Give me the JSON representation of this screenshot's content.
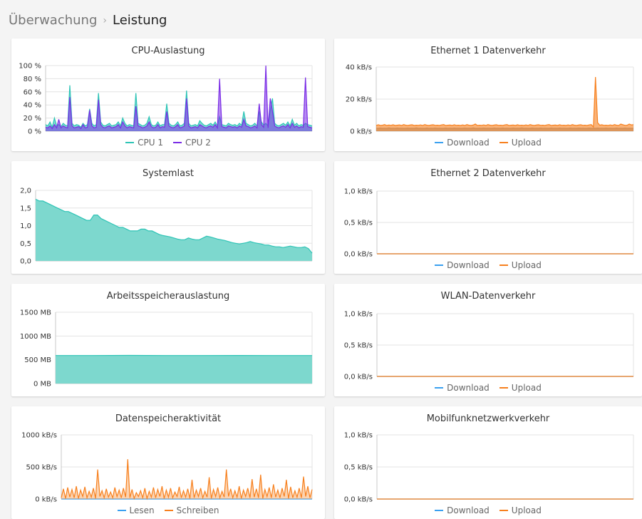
{
  "breadcrumb": {
    "parent": "Überwachung",
    "separator": "›",
    "current": "Leistung"
  },
  "colors": {
    "teal": "#2ec4b6",
    "teal_fill": "#7dd8ce",
    "purple": "#7a2ce6",
    "orange": "#f7801e",
    "blue": "#3aa0f0",
    "gray": "#9a9a9a"
  },
  "panels": {
    "cpu": {
      "title": "CPU-Auslastung",
      "y_ticks": [
        "100 %",
        "80 %",
        "60 %",
        "40 %",
        "20 %",
        "0 %"
      ],
      "legend": [
        "CPU 1",
        "CPU 2"
      ]
    },
    "eth1": {
      "title": "Ethernet 1 Datenverkehr",
      "y_ticks": [
        "40 kB/s",
        "20 kB/s",
        "0 kB/s"
      ],
      "legend": [
        "Download",
        "Upload"
      ]
    },
    "load": {
      "title": "Systemlast",
      "y_ticks": [
        "2,0",
        "1,5",
        "1,0",
        "0,5",
        "0,0"
      ]
    },
    "eth2": {
      "title": "Ethernet 2 Datenverkehr",
      "y_ticks": [
        "1,0 kB/s",
        "0,5 kB/s",
        "0,0 kB/s"
      ],
      "legend": [
        "Download",
        "Upload"
      ]
    },
    "mem": {
      "title": "Arbeitsspeicherauslastung",
      "y_ticks": [
        "1500 MB",
        "1000 MB",
        "500 MB",
        "0 MB"
      ]
    },
    "wlan": {
      "title": "WLAN-Datenverkehr",
      "y_ticks": [
        "1,0 kB/s",
        "0,5 kB/s",
        "0,0 kB/s"
      ],
      "legend": [
        "Download",
        "Upload"
      ]
    },
    "disk": {
      "title": "Datenspeicheraktivität",
      "y_ticks": [
        "1000 kB/s",
        "500 kB/s",
        "0 kB/s"
      ],
      "legend": [
        "Lesen",
        "Schreiben"
      ]
    },
    "mobile": {
      "title": "Mobilfunknetzwerkverkehr",
      "y_ticks": [
        "1,0 kB/s",
        "0,5 kB/s",
        "0,0 kB/s"
      ],
      "legend": [
        "Download",
        "Upload"
      ]
    }
  },
  "chart_data": [
    {
      "id": "cpu",
      "type": "area",
      "title": "CPU-Auslastung",
      "ylim": [
        0,
        100
      ],
      "series": [
        {
          "name": "CPU 1",
          "color": "#2ec4b6",
          "values": [
            10,
            8,
            14,
            6,
            20,
            8,
            10,
            7,
            12,
            9,
            8,
            70,
            12,
            8,
            10,
            9,
            6,
            12,
            8,
            10,
            34,
            12,
            8,
            10,
            58,
            14,
            9,
            8,
            10,
            12,
            8,
            9,
            10,
            14,
            8,
            20,
            12,
            8,
            10,
            9,
            8,
            58,
            12,
            10,
            8,
            9,
            12,
            22,
            10,
            8,
            9,
            14,
            8,
            10,
            10,
            42,
            12,
            9,
            8,
            10,
            14,
            8,
            9,
            12,
            62,
            12,
            8,
            9,
            10,
            8,
            16,
            12,
            9,
            8,
            10,
            12,
            9,
            14,
            8,
            22,
            10,
            9,
            8,
            12,
            10,
            9,
            10,
            8,
            12,
            9,
            30,
            12,
            10,
            8,
            9,
            12,
            8,
            30,
            14,
            9,
            12,
            8,
            32,
            50,
            12,
            9,
            8,
            10,
            12,
            9,
            14,
            8,
            18,
            9,
            12,
            8,
            10,
            9,
            12,
            10,
            9,
            8
          ]
        },
        {
          "name": "CPU 2",
          "color": "#7a2ce6",
          "values": [
            6,
            5,
            8,
            4,
            10,
            5,
            18,
            5,
            8,
            6,
            5,
            52,
            8,
            5,
            6,
            7,
            4,
            10,
            5,
            6,
            32,
            8,
            5,
            6,
            48,
            10,
            6,
            5,
            7,
            8,
            5,
            6,
            7,
            10,
            5,
            14,
            8,
            5,
            7,
            6,
            5,
            38,
            8,
            7,
            5,
            6,
            8,
            14,
            7,
            5,
            6,
            10,
            5,
            7,
            6,
            30,
            8,
            6,
            5,
            7,
            10,
            5,
            6,
            8,
            50,
            8,
            5,
            6,
            7,
            5,
            10,
            8,
            6,
            5,
            7,
            8,
            6,
            10,
            5,
            80,
            7,
            6,
            5,
            8,
            7,
            6,
            7,
            5,
            8,
            6,
            18,
            8,
            7,
            5,
            6,
            8,
            5,
            42,
            10,
            6,
            100,
            5,
            50,
            30,
            8,
            6,
            5,
            7,
            8,
            6,
            10,
            5,
            12,
            6,
            8,
            5,
            7,
            6,
            82,
            7,
            6,
            5
          ]
        }
      ]
    },
    {
      "id": "eth1",
      "type": "area",
      "title": "Ethernet 1 Datenverkehr",
      "ylim": [
        0,
        45
      ],
      "series": [
        {
          "name": "Download",
          "color": "#9a9a9a",
          "values": [
            2,
            2,
            2.2,
            2,
            2.1,
            2,
            2.3,
            2,
            2.1,
            2,
            2.2,
            2,
            2.1,
            2,
            2,
            2.2,
            2,
            2.1,
            2,
            2.3,
            2,
            2.1,
            2,
            2,
            2.2,
            2,
            2.1,
            2,
            2.2,
            2,
            2.1,
            2,
            2,
            2.2,
            2,
            2.1,
            2,
            2.2,
            2,
            2.1,
            2,
            2,
            2.2,
            2,
            2.1,
            2,
            2.3,
            2,
            2,
            2.1,
            2,
            2.2,
            2,
            2.1,
            2,
            2,
            2.2,
            2,
            2.1,
            2,
            2.2,
            2,
            2.1,
            2,
            2,
            2.2,
            2,
            2.1,
            2,
            2.3,
            2,
            2.1,
            2,
            2,
            2.2,
            2,
            2.1,
            2,
            2.2,
            2,
            2.1,
            2,
            2,
            2.2,
            2,
            2.1,
            2,
            2.2,
            2,
            2.1,
            2,
            2,
            2.2,
            2,
            2.1,
            2,
            2.2,
            2,
            2.1,
            2,
            2,
            2.2,
            2,
            2.1,
            2,
            2.2,
            2,
            2.1,
            2,
            2.2,
            2,
            2.1,
            2,
            2,
            2.2,
            2,
            2.1,
            2,
            2.2,
            2,
            2.1,
            2,
            2
          ]
        },
        {
          "name": "Upload",
          "color": "#f7801e",
          "values": [
            4,
            4.5,
            4,
            4.2,
            4.6,
            4,
            4.3,
            4.1,
            4.5,
            4,
            4.2,
            4.4,
            4,
            4.6,
            4.2,
            4,
            4.3,
            4.5,
            4,
            4.2,
            4.1,
            4.4,
            4,
            4.6,
            4.2,
            4,
            4.3,
            4.5,
            4.1,
            4.2,
            4,
            4.4,
            4.6,
            4,
            4.2,
            4.3,
            4,
            4.5,
            4.1,
            4.2,
            4,
            4.4,
            4,
            4.6,
            4.2,
            4,
            4.3,
            5,
            4,
            4.2,
            4.1,
            4.4,
            4,
            4.6,
            4.2,
            4,
            4.3,
            4.5,
            4.1,
            4.2,
            4,
            4.4,
            4.6,
            4,
            4.2,
            4.3,
            4,
            4.5,
            4.1,
            4.2,
            4,
            4.4,
            4,
            4.6,
            4.2,
            4,
            4.3,
            4.5,
            4.1,
            4.2,
            4,
            4.4,
            4.6,
            4,
            4.2,
            4.3,
            4,
            4.5,
            4.1,
            4.2,
            4,
            4.4,
            4,
            4.6,
            4.2,
            4,
            4.3,
            4.5,
            4.1,
            4.2,
            4,
            4.4,
            4.6,
            3,
            38,
            6,
            4.2,
            4.5,
            4.1,
            4.2,
            4,
            4.4,
            4,
            4.6,
            4.2,
            4,
            5,
            4.5,
            4.1,
            4.2,
            5,
            4.4,
            4.6
          ]
        }
      ]
    },
    {
      "id": "load",
      "type": "area",
      "title": "Systemlast",
      "ylim": [
        0,
        2.0
      ],
      "series": [
        {
          "name": "",
          "color": "#2ec4b6",
          "values": [
            1.75,
            1.7,
            1.7,
            1.65,
            1.6,
            1.55,
            1.5,
            1.45,
            1.4,
            1.4,
            1.35,
            1.3,
            1.25,
            1.2,
            1.15,
            1.15,
            1.3,
            1.3,
            1.2,
            1.15,
            1.1,
            1.05,
            1.0,
            0.95,
            0.95,
            0.9,
            0.85,
            0.85,
            0.85,
            0.9,
            0.9,
            0.85,
            0.85,
            0.8,
            0.75,
            0.72,
            0.7,
            0.68,
            0.65,
            0.62,
            0.6,
            0.6,
            0.65,
            0.62,
            0.6,
            0.6,
            0.65,
            0.7,
            0.68,
            0.65,
            0.62,
            0.6,
            0.58,
            0.55,
            0.52,
            0.5,
            0.48,
            0.5,
            0.52,
            0.55,
            0.52,
            0.5,
            0.48,
            0.45,
            0.45,
            0.42,
            0.4,
            0.4,
            0.38,
            0.4,
            0.42,
            0.4,
            0.38,
            0.38,
            0.4,
            0.35,
            0.22
          ]
        }
      ]
    },
    {
      "id": "eth2",
      "type": "line",
      "title": "Ethernet 2 Datenverkehr",
      "ylim": [
        0,
        1.0
      ],
      "series": [
        {
          "name": "Download",
          "color": "#3aa0f0",
          "values": [
            0,
            0
          ]
        },
        {
          "name": "Upload",
          "color": "#f7801e",
          "values": [
            0,
            0
          ]
        }
      ]
    },
    {
      "id": "mem",
      "type": "area",
      "title": "Arbeitsspeicherauslastung",
      "ylim": [
        0,
        1500
      ],
      "series": [
        {
          "name": "",
          "color": "#2ec4b6",
          "values": [
            590,
            590,
            592,
            590,
            590,
            591,
            590,
            590
          ]
        }
      ]
    },
    {
      "id": "wlan",
      "type": "line",
      "title": "WLAN-Datenverkehr",
      "ylim": [
        0,
        1.0
      ],
      "series": [
        {
          "name": "Download",
          "color": "#3aa0f0",
          "values": [
            0,
            0
          ]
        },
        {
          "name": "Upload",
          "color": "#f7801e",
          "values": [
            0,
            0
          ]
        }
      ]
    },
    {
      "id": "disk",
      "type": "area",
      "title": "Datenspeicheraktivität",
      "ylim": [
        0,
        1000
      ],
      "series": [
        {
          "name": "Lesen",
          "color": "#3aa0f0",
          "values": [
            0,
            0
          ]
        },
        {
          "name": "Schreiben",
          "color": "#f7801e",
          "values": [
            20,
            160,
            10,
            180,
            30,
            150,
            20,
            200,
            10,
            140,
            40,
            190,
            20,
            120,
            30,
            170,
            10,
            460,
            40,
            130,
            20,
            160,
            30,
            110,
            20,
            180,
            40,
            140,
            20,
            170,
            30,
            620,
            20,
            150,
            10,
            100,
            40,
            130,
            20,
            170,
            10,
            120,
            30,
            180,
            20,
            150,
            40,
            200,
            10,
            140,
            30,
            170,
            20,
            110,
            40,
            190,
            20,
            130,
            30,
            160,
            10,
            300,
            20,
            140,
            40,
            170,
            20,
            120,
            30,
            340,
            10,
            150,
            40,
            180,
            20,
            120,
            30,
            460,
            40,
            160,
            20,
            130,
            30,
            200,
            10,
            140,
            40,
            170,
            20,
            310,
            30,
            160,
            20,
            380,
            10,
            150,
            40,
            180,
            20,
            230,
            30,
            140,
            20,
            170,
            40,
            300,
            10,
            190,
            20,
            130,
            30,
            170,
            20,
            350,
            40,
            200,
            20,
            150
          ]
        }
      ]
    },
    {
      "id": "mobile",
      "type": "line",
      "title": "Mobilfunknetzwerkverkehr",
      "ylim": [
        0,
        1.0
      ],
      "series": [
        {
          "name": "Download",
          "color": "#3aa0f0",
          "values": [
            0,
            0
          ]
        },
        {
          "name": "Upload",
          "color": "#f7801e",
          "values": [
            0,
            0
          ]
        }
      ]
    }
  ]
}
